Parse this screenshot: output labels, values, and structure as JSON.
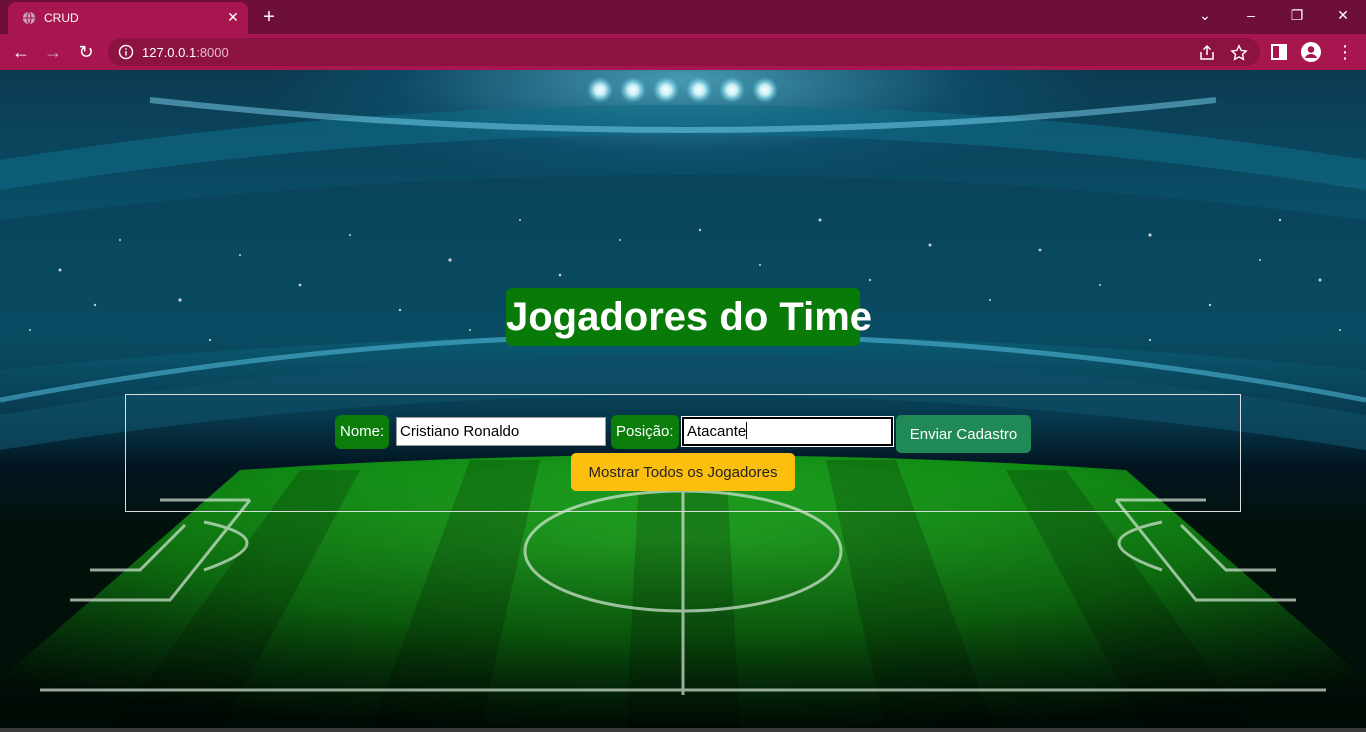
{
  "browser": {
    "tab_title": "CRUD",
    "url_host": "127.0.0.1",
    "url_port": ":8000",
    "colors": {
      "frame": "#6e0f3a",
      "toolbar": "#a8164f"
    }
  },
  "page": {
    "heading": "Jogadores do Time",
    "form": {
      "nome_label": "Nome:",
      "nome_value": "Cristiano Ronaldo",
      "posicao_label": "Posição:",
      "posicao_value": "Atacante",
      "submit_label": "Enviar Cadastro",
      "show_all_label": "Mostrar Todos os Jogadores"
    },
    "colors": {
      "heading_bg": "#087a08",
      "submit_bg": "#1f8a55",
      "show_all_bg": "#fdbf0d"
    }
  }
}
